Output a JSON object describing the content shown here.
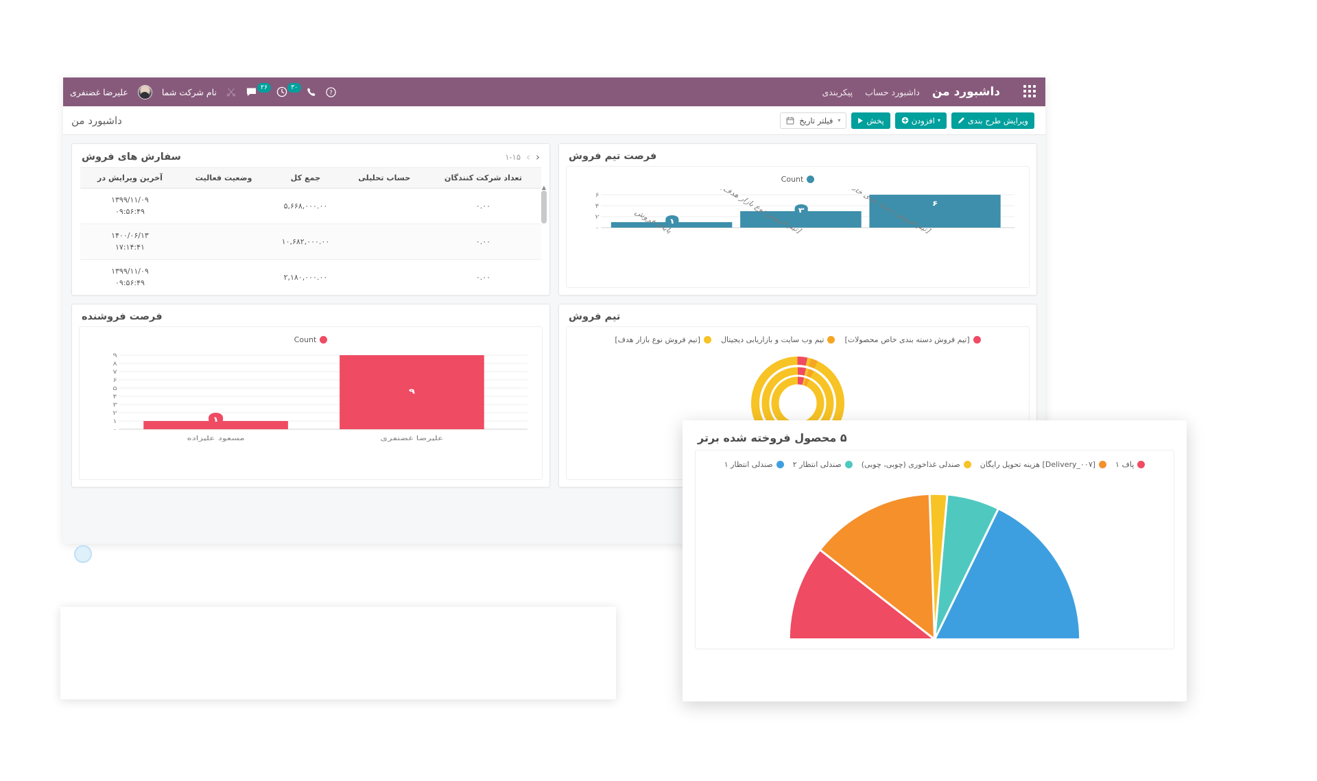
{
  "navbar": {
    "apps_icon": "apps-grid-icon",
    "brand": "داشبورد من",
    "links": [
      {
        "label": "داشبورد حساب"
      },
      {
        "label": "پیکربندی"
      }
    ],
    "help_icon": "question-circle-icon",
    "phone_icon": "phone-icon",
    "activities": {
      "icon": "clock-icon",
      "count": "۳۰"
    },
    "messages": {
      "icon": "chat-bubble-icon",
      "count": "۲۶"
    },
    "tools_icon": "scissors-icon",
    "company": "نام شرکت شما",
    "avatar": "user-avatar",
    "user": "علیرضا غضنفری"
  },
  "control_bar": {
    "title": "داشبورد من",
    "date_filter": {
      "icon": "calendar-icon",
      "label": "فیلتر تاریخ",
      "caret": "▾"
    },
    "play": {
      "icon": "play-icon",
      "label": "پخش"
    },
    "add": {
      "icon": "plus-circle-icon",
      "label": "افزودن",
      "caret": "▾"
    },
    "edit_layout": {
      "icon": "pencil-icon",
      "label": "ویرایش طرح بندی"
    }
  },
  "cards": {
    "sales_orders": {
      "title": "سفارش های فروش",
      "pager": {
        "range": "۱-۱۵",
        "next": "›",
        "prev": "‹"
      },
      "columns": [
        "آخرین ویرایش در",
        "وضعیت فعالیت",
        "جمع کل",
        "حساب تحلیلی",
        "تعداد شرکت کنندگان"
      ],
      "rows": [
        {
          "modified": "۱۳۹۹/۱۱/۰۹",
          "time": "۰۹:۵۶:۴۹",
          "status": "",
          "total": "۵,۶۶۸,۰۰۰.۰۰",
          "analytic": "",
          "participants": "۰.۰۰"
        },
        {
          "modified": "۱۴۰۰/۰۶/۱۳",
          "time": "۱۷:۱۴:۴۱",
          "status": "",
          "total": "۱۰,۶۸۲,۰۰۰.۰۰",
          "analytic": "",
          "participants": "۰.۰۰"
        },
        {
          "modified": "۱۳۹۹/۱۱/۰۹",
          "time": "۰۹:۵۶:۴۹",
          "status": "",
          "total": "۲,۱۸۰,۰۰۰.۰۰",
          "analytic": "",
          "participants": "۰.۰۰"
        }
      ]
    },
    "team_opportunity": {
      "title": "فرصت تیم فروش"
    },
    "seller_opportunity": {
      "title": "فرصت فروشنده"
    },
    "sales_team": {
      "title": "تیم فروش"
    },
    "top_products": {
      "title": "۵ محصول فروخته شده برتر"
    }
  },
  "chart_data": [
    {
      "id": "team_opportunity",
      "type": "bar",
      "title": "فرصت تیم فروش",
      "legend": [
        {
          "name": "Count",
          "color": "#3d8fab"
        }
      ],
      "legend_position": "top",
      "categories": [
        "پایانه فروش",
        "[تیم فروش نوع بازار هدف]",
        "[تیم فروش دسته بندی خاص محصولات]"
      ],
      "values": [
        1,
        3,
        6
      ],
      "value_labels": [
        "۱",
        "۳",
        "۶"
      ],
      "ylim": [
        0,
        6
      ],
      "yticks": [
        0,
        2,
        4,
        6
      ],
      "ytick_labels": [
        "۰",
        "۲",
        "۴",
        "۶"
      ],
      "grid": true,
      "color": "#3d8fab"
    },
    {
      "id": "seller_opportunity",
      "type": "bar",
      "title": "فرصت فروشنده",
      "legend": [
        {
          "name": "Count",
          "color": "#ef4b63"
        }
      ],
      "legend_position": "top",
      "categories": [
        "مسعود علیزاده",
        "علیرضا غضنفری"
      ],
      "values": [
        1,
        9
      ],
      "value_labels": [
        "۱",
        "۹"
      ],
      "ylim": [
        0,
        9
      ],
      "yticks": [
        0,
        1,
        2,
        3,
        4,
        5,
        6,
        7,
        8,
        9
      ],
      "ytick_labels": [
        "۰",
        "۱",
        "۲",
        "۳",
        "۴",
        "۵",
        "۶",
        "۷",
        "۸",
        "۹"
      ],
      "grid": true,
      "color": "#ef4b63"
    },
    {
      "id": "sales_team",
      "type": "pie",
      "title": "تیم فروش",
      "legend_position": "top",
      "labels": [
        "[تیم فروش دسته بندی خاص محصولات]",
        "تیم وب سایت و بازاریابی دیجیتال",
        "[تیم فروش نوع بازار هدف]"
      ],
      "colors": [
        "#ef4b63",
        "#f5a623",
        "#f7c325"
      ],
      "rings": [
        {
          "values": [
            0.06,
            0.04,
            0.9
          ],
          "colors": [
            "#ef4b63",
            "#f5a623",
            "#f7c325"
          ]
        },
        {
          "values": [
            0.04,
            0.03,
            0.93
          ],
          "colors": [
            "#ef4b63",
            "#f5a623",
            "#f7c325"
          ]
        },
        {
          "values": [
            0.03,
            0.02,
            0.95
          ],
          "colors": [
            "#ef4b63",
            "#f5a623",
            "#f7c325"
          ]
        }
      ]
    },
    {
      "id": "top_products",
      "type": "pie",
      "title": "۵ محصول فروخته شده برتر",
      "variant": "half-donut",
      "legend_position": "top",
      "labels": [
        "پاف ۱",
        "[Delivery_۰۰۷] هزینه تحویل رایگان",
        "صندلی غذاخوری (چوبی، چوبی)",
        "صندلی انتظار ۲",
        "صندلی انتظار ۱"
      ],
      "colors": [
        "#ef4b63",
        "#f5902b",
        "#f7c325",
        "#4fc9c0",
        "#3e9fe0"
      ],
      "values": [
        38,
        50,
        7,
        21,
        64
      ],
      "total_degrees": 180
    }
  ]
}
